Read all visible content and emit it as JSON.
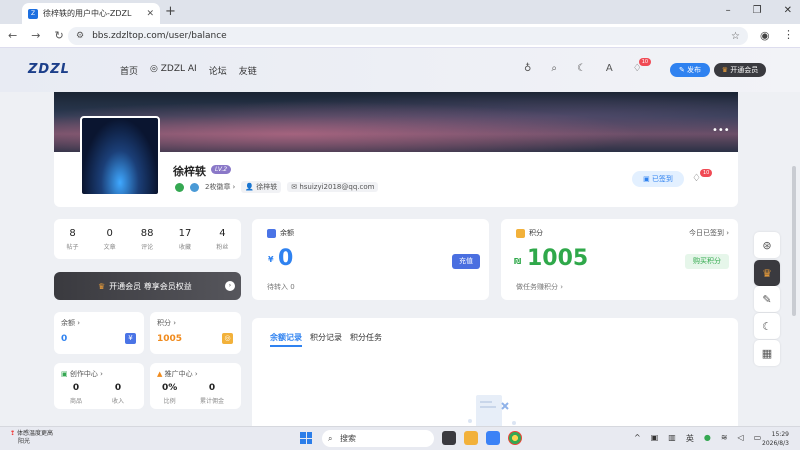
{
  "browser": {
    "tab_title": "徐梓轶的用户中心-ZDZL",
    "url": "bbs.zdzltop.com/user/balance"
  },
  "header": {
    "logo": "ZDZL",
    "nav": [
      "首页",
      "◎ ZDZL AI",
      "论坛",
      "友链"
    ],
    "notif_count": "10",
    "publish_label": "发布",
    "vip_label": "开通会员"
  },
  "profile": {
    "name": "徐梓轶",
    "level": "LV.2",
    "badges_label": "2枚徽章",
    "nickname": "徐梓轶",
    "email": "hsuizyi2018@qq.com",
    "signed_label": "已签到",
    "notif_count": "10"
  },
  "stats": [
    {
      "value": "8",
      "label": "帖子"
    },
    {
      "value": "0",
      "label": "文章"
    },
    {
      "value": "88",
      "label": "评论"
    },
    {
      "value": "17",
      "label": "收藏"
    },
    {
      "value": "4",
      "label": "粉丝"
    }
  ],
  "vip_banner": {
    "label": "开通会员 尊享会员权益"
  },
  "mini_balance": {
    "title": "余额",
    "value": "0"
  },
  "mini_points": {
    "title": "积分",
    "value": "1005"
  },
  "creator": {
    "title": "创作中心",
    "items": [
      {
        "value": "0",
        "label": "商品"
      },
      {
        "value": "0",
        "label": "收入"
      }
    ]
  },
  "promo": {
    "title": "推广中心",
    "items": [
      {
        "value": "0%",
        "label": "比例"
      },
      {
        "value": "0",
        "label": "累计佣金"
      }
    ]
  },
  "balance_card": {
    "title": "余额",
    "currency": "¥",
    "amount": "0",
    "recharge_label": "充值",
    "pending": "待转入 0"
  },
  "points_card": {
    "title": "积分",
    "signed_today": "今日已签到",
    "amount": "1005",
    "buy_label": "购买积分",
    "earn_label": "做任务赚积分"
  },
  "record_tabs": [
    "余额记录",
    "积分记录",
    "积分任务"
  ],
  "taskbar": {
    "weather_title": "体感温度更高",
    "weather_sub": "阳光",
    "search": "搜索",
    "ime": "英",
    "time": "15:29",
    "date": "2026/8/3"
  }
}
